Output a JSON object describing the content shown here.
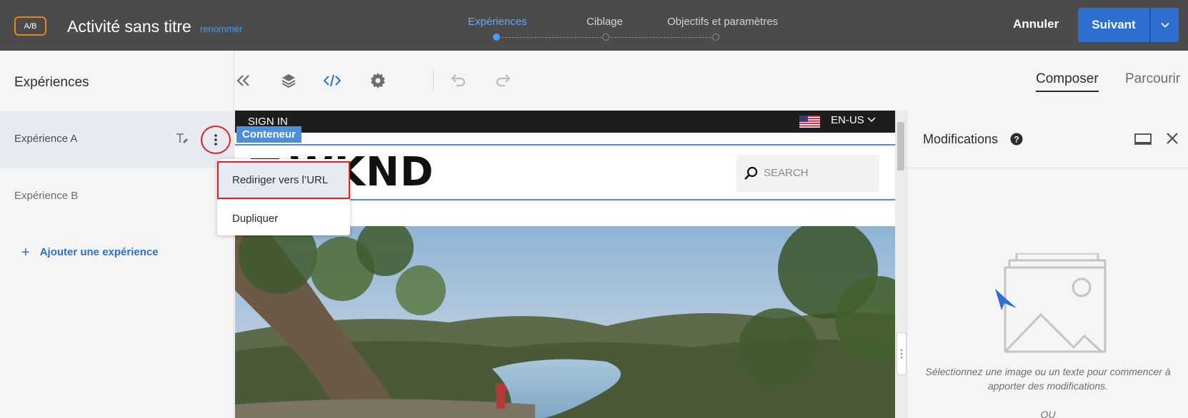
{
  "topbar": {
    "badge": "A/B",
    "activity_title": "Activité sans titre",
    "rename_label": "renommer",
    "steps": [
      {
        "label": "Expériences",
        "active": true
      },
      {
        "label": "Ciblage",
        "active": false
      },
      {
        "label": "Objectifs et paramètres",
        "active": false
      }
    ],
    "cancel_label": "Annuler",
    "next_label": "Suivant",
    "accent_color": "#2d6fd1"
  },
  "left_panel": {
    "title": "Expériences",
    "experiences": [
      {
        "label": "Expérience A",
        "selected": true
      },
      {
        "label": "Expérience B",
        "selected": false
      }
    ],
    "add_label": "Ajouter une expérience",
    "menu": {
      "items": [
        {
          "label": "Rediriger vers l’URL",
          "highlighted": true
        },
        {
          "label": "Dupliquer",
          "highlighted": false
        }
      ]
    }
  },
  "toolbar": {
    "icons": [
      "collapse-icon",
      "layers-icon",
      "code-icon",
      "settings-icon",
      "undo-icon",
      "redo-icon"
    ],
    "tab_compose": "Composer",
    "tab_browse": "Parcourir"
  },
  "preview": {
    "sign_in": "SIGN IN",
    "language": "EN-US",
    "container_tag": "Conteneur",
    "logo": "WKND",
    "search_placeholder": "SEARCH"
  },
  "right_panel": {
    "title": "Modifications",
    "hint": "Sélectionnez une image ou un texte pour commencer à apporter des modifications.",
    "or": "OU"
  }
}
